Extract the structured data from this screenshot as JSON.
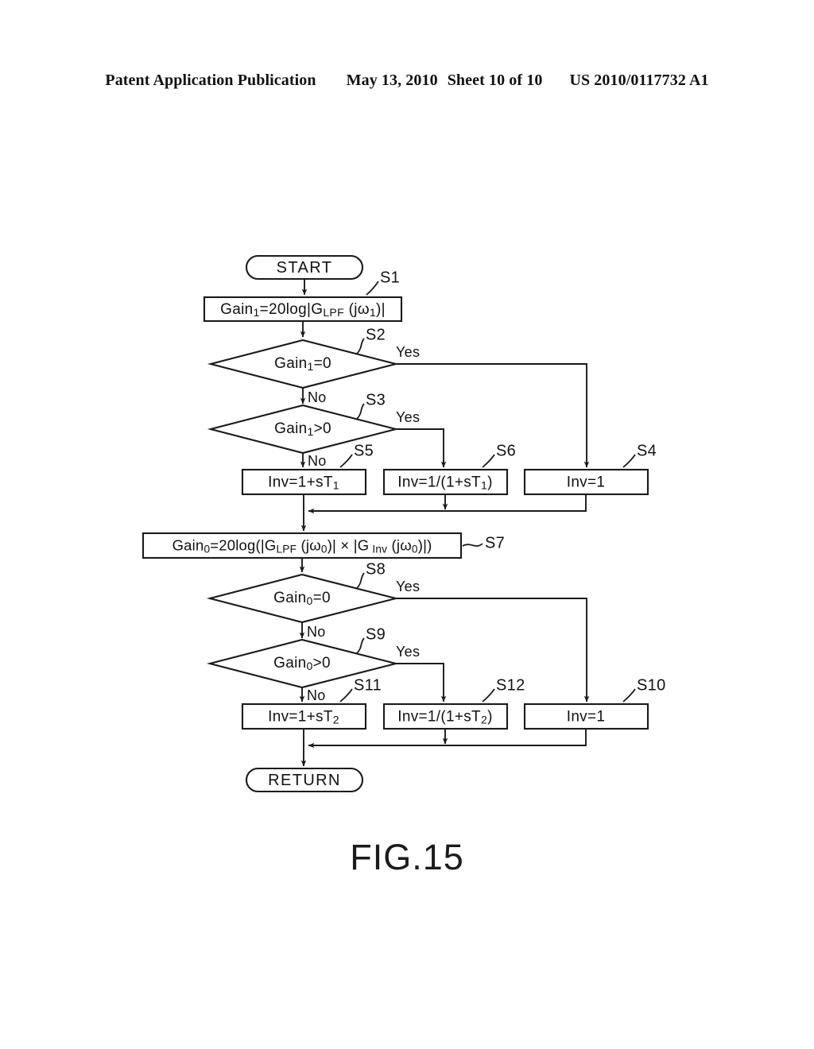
{
  "header": {
    "publication": "Patent Application Publication",
    "date": "May 13, 2010",
    "sheet": "Sheet 10 of 10",
    "patent_number": "US 2010/0117732 A1"
  },
  "figure": {
    "caption": "FIG.15"
  },
  "branch_labels": {
    "yes": "Yes",
    "no": "No"
  },
  "flowchart": {
    "terminals": {
      "start": "START",
      "return": "RETURN"
    },
    "steps": [
      {
        "id": "S1",
        "label": "S1",
        "type": "process",
        "text": "Gain1=20log|GLPF (jω1)|"
      },
      {
        "id": "S2",
        "label": "S2",
        "type": "decision",
        "text": "Gain1=0"
      },
      {
        "id": "S3",
        "label": "S3",
        "type": "decision",
        "text": "Gain1>0"
      },
      {
        "id": "S5",
        "label": "S5",
        "type": "process",
        "text": "Inv=1+sT1"
      },
      {
        "id": "S6",
        "label": "S6",
        "type": "process",
        "text": "Inv=1/(1+sT1)"
      },
      {
        "id": "S4",
        "label": "S4",
        "type": "process",
        "text": "Inv=1"
      },
      {
        "id": "S7",
        "label": "S7",
        "type": "process",
        "text": "Gain0=20log(|GLPF (jω0)| × |GInv (jω0)|)"
      },
      {
        "id": "S8",
        "label": "S8",
        "type": "decision",
        "text": "Gain0=0"
      },
      {
        "id": "S9",
        "label": "S9",
        "type": "decision",
        "text": "Gain0>0"
      },
      {
        "id": "S11",
        "label": "S11",
        "type": "process",
        "text": "Inv=1+sT2"
      },
      {
        "id": "S12",
        "label": "S12",
        "type": "process",
        "text": "Inv=1/(1+sT2)"
      },
      {
        "id": "S10",
        "label": "S10",
        "type": "process",
        "text": "Inv=1"
      }
    ]
  },
  "colors": {
    "ink": "#1a1a1a",
    "paper": "#ffffff"
  }
}
